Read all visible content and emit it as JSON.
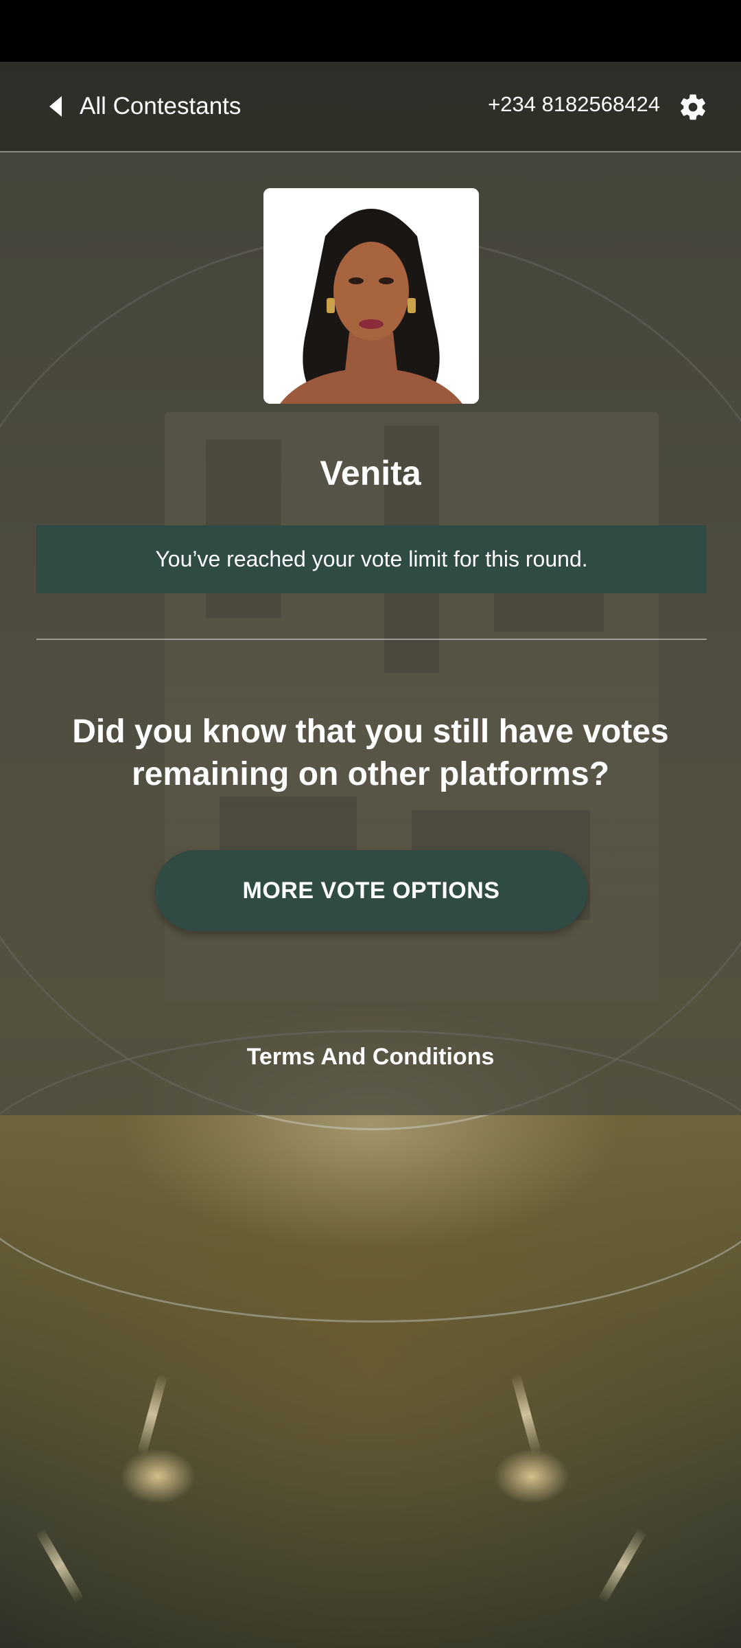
{
  "header": {
    "back_label": "All Contestants",
    "back_icon": "caret-left-icon",
    "phone_number": "+234 8182568424",
    "settings_icon": "gear-icon"
  },
  "contestant": {
    "name": "Venita",
    "photo": "contestant-portrait"
  },
  "notice": {
    "text": "You’ve reached your vote limit for this round."
  },
  "promo": {
    "question": "Did you know that you still have votes remaining on other platforms?",
    "button_label": "MORE VOTE OPTIONS"
  },
  "footer": {
    "terms_label": "Terms And Conditions"
  },
  "colors": {
    "accent": "#2f4b44",
    "status_bar": "#000000",
    "text": "#ffffff"
  }
}
